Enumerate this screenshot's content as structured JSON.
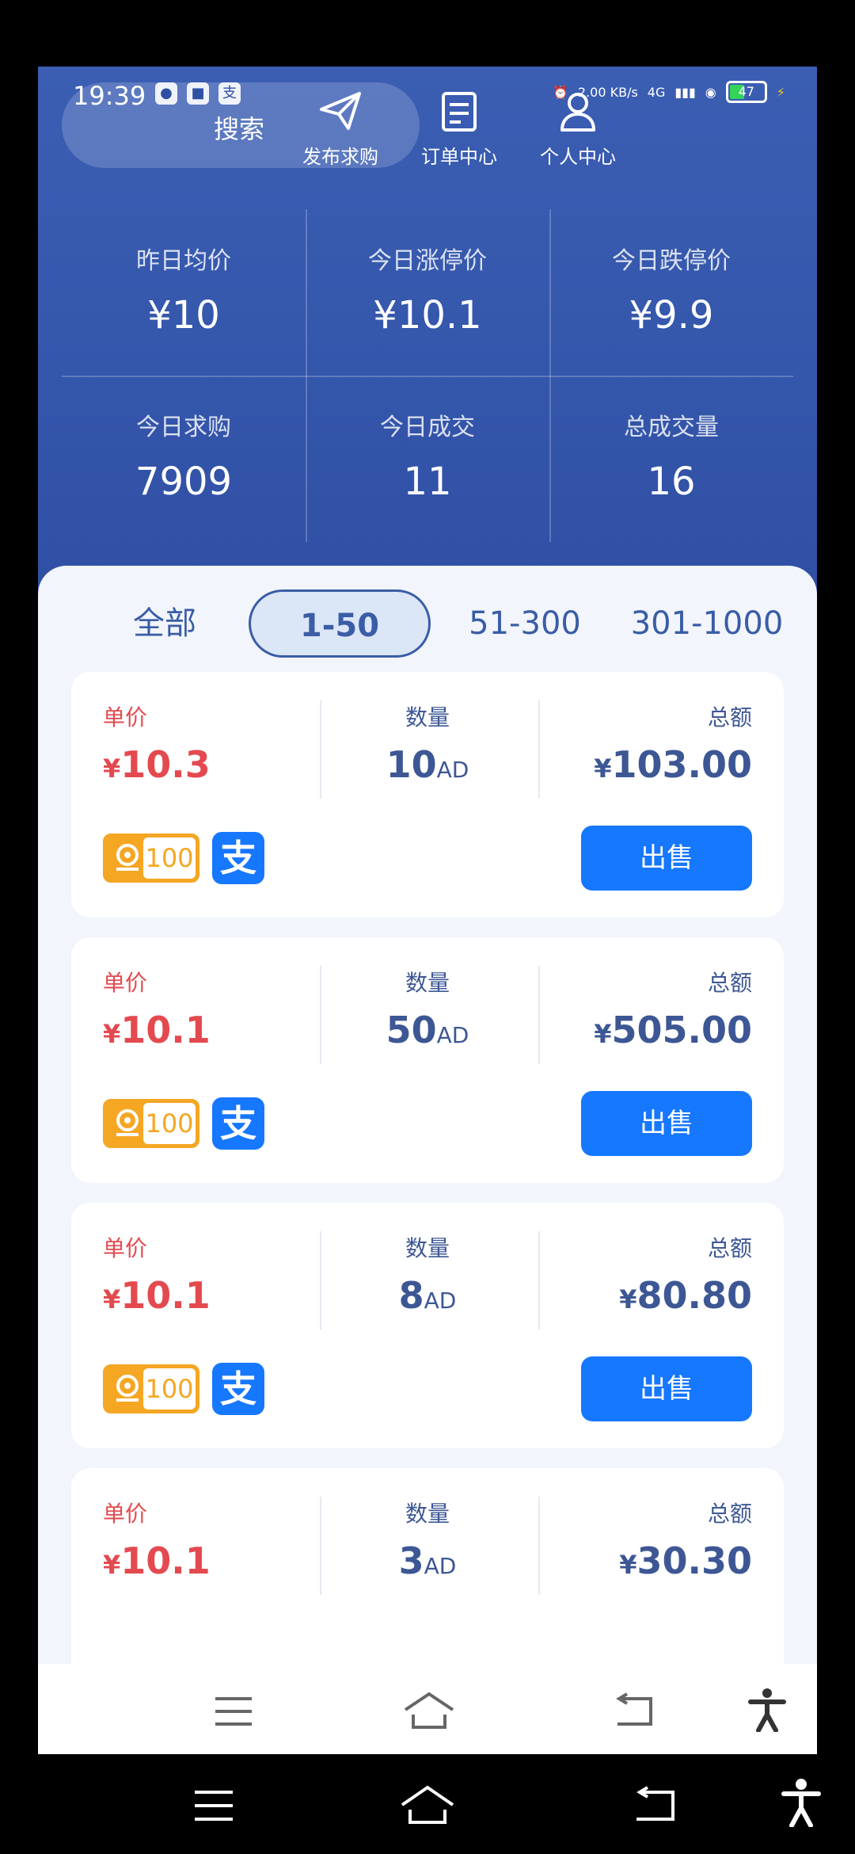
{
  "status_bar": {
    "time": "19:39",
    "speed": "2.00 KB/s",
    "network": "4G",
    "battery": "47"
  },
  "header": {
    "search_label": "搜索",
    "actions": [
      {
        "label": "发布求购",
        "icon": "paper-plane-icon"
      },
      {
        "label": "订单中心",
        "icon": "document-icon"
      },
      {
        "label": "个人中心",
        "icon": "person-icon"
      }
    ]
  },
  "stats": [
    {
      "label": "昨日均价",
      "value": "¥10"
    },
    {
      "label": "今日涨停价",
      "value": "¥10.1"
    },
    {
      "label": "今日跌停价",
      "value": "¥9.9"
    },
    {
      "label": "今日求购",
      "value": "7909"
    },
    {
      "label": "今日成交",
      "value": "11"
    },
    {
      "label": "总成交量",
      "value": "16"
    }
  ],
  "tabs": [
    {
      "label": "全部",
      "active": false
    },
    {
      "label": "1-50",
      "active": true
    },
    {
      "label": "51-300",
      "active": false
    },
    {
      "label": "301-1000",
      "active": false
    }
  ],
  "column_labels": {
    "price": "单价",
    "qty": "数量",
    "total": "总额"
  },
  "currency_symbol": "¥",
  "qty_unit": "AD",
  "rank_badge_value": "100",
  "pay_badge_glyph": "支",
  "sell_label": "出售",
  "orders": [
    {
      "price": "10.3",
      "qty": "10",
      "total": "103.00"
    },
    {
      "price": "10.1",
      "qty": "50",
      "total": "505.00"
    },
    {
      "price": "10.1",
      "qty": "8",
      "total": "80.80"
    },
    {
      "price": "10.1",
      "qty": "3",
      "total": "30.30"
    }
  ],
  "colors": {
    "header_blue": "#3456ab",
    "price_red": "#e34a4f",
    "sell_blue": "#1677ff",
    "rank_orange": "#f5a623"
  }
}
